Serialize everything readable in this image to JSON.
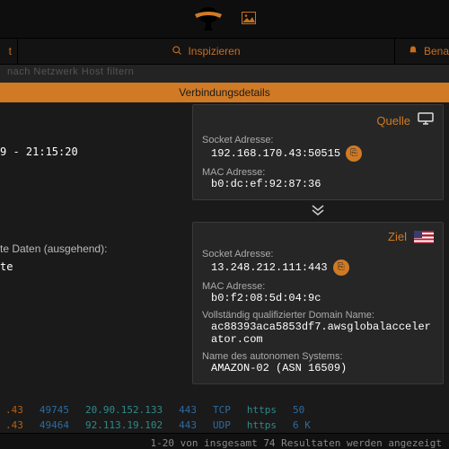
{
  "app": {
    "filter_placeholder": "nach Netzwerk Host filtern"
  },
  "tabs": {
    "left_partial": "t",
    "inspect": "Inspizieren",
    "right_partial": "Bena"
  },
  "modal": {
    "title": "Verbindungsdetails"
  },
  "left": {
    "time": "9 - 21:15:20",
    "outgoing_label": "te Daten (ausgehend):",
    "outgoing_value": "te"
  },
  "source": {
    "heading": "Quelle",
    "socket_label": "Socket Adresse:",
    "socket_value": "192.168.170.43:50515",
    "mac_label": "MAC Adresse:",
    "mac_value": "b0:dc:ef:92:87:36"
  },
  "dest": {
    "heading": "Ziel",
    "socket_label": "Socket Adresse:",
    "socket_value": "13.248.212.111:443",
    "mac_label": "MAC Adresse:",
    "mac_value": "b0:f2:08:5d:04:9c",
    "fqdn_label": "Vollständig qualifizierter Domain Name:",
    "fqdn_value": "ac88393aca5853df7.awsglobalaccelerator.com",
    "asn_label": "Name des autonomen Systems:",
    "asn_value": "AMAZON-02 (ASN 16509)"
  },
  "bg_rows": [
    {
      "port": ".43",
      "pid": "49745",
      "ip": "20.90.152.133",
      "rport": "443",
      "proto": "TCP",
      "svc": "https",
      "extra": "50"
    },
    {
      "port": ".43",
      "pid": "49464",
      "ip": "92.113.19.102",
      "rport": "443",
      "proto": "UDP",
      "svc": "https",
      "extra": "6 K"
    }
  ],
  "pager": {
    "text": "1-20 von insgesamt 74 Resultaten werden angezeigt"
  }
}
